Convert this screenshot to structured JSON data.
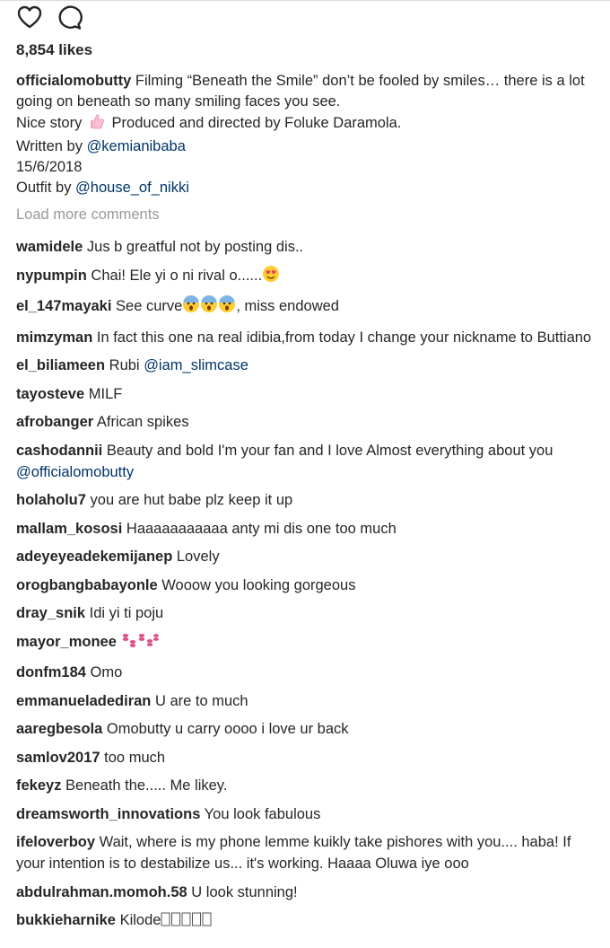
{
  "post": {
    "likes": "8,854 likes",
    "caption": {
      "username": "officialomobutty",
      "line1": "Filming “Beneath the Smile” don’t be fooled by smiles… there is a lot going on beneath so many smiling faces you see.",
      "line2_a": "Nice story",
      "line2_b": "Produced and directed by Foluke Daramola.",
      "line3_prefix": "Written by",
      "line3_mention": "@kemianibaba",
      "line4": "15/6/2018",
      "line5_prefix": "Outfit by",
      "line5_mention": "@house_of_nikki"
    },
    "load_more": "Load more comments"
  },
  "icons": {
    "like": "heart-icon",
    "comment": "comment-bubble-icon",
    "thumbs": "thumbs-up-icon",
    "love_face": "heart-eyes-emoji",
    "scared_face": "screaming-face-emoji",
    "kisses": "kiss-marks-emoji"
  },
  "comments": [
    {
      "user": "wamidele",
      "text": "Jus b greatful not by posting dis.."
    },
    {
      "user": "nypumpin",
      "text": "Chai! Ele yi o ni rival o......"
    },
    {
      "user": "el_147mayaki",
      "text": "See curve",
      "text_after": ", miss endowed"
    },
    {
      "user": "mimzyman",
      "text": "In fact this one na real idibia,from today I change your nickname to Buttiano"
    },
    {
      "user": "el_biliameen",
      "text": "Rubi",
      "mention": "@iam_slimcase"
    },
    {
      "user": "tayosteve",
      "text": "MILF"
    },
    {
      "user": "afrobanger",
      "text": "African spikes"
    },
    {
      "user": "cashodannii",
      "text": "Beauty and bold I'm your fan and I love Almost everything about you",
      "mention": "@officialomobutty"
    },
    {
      "user": "holaholu7",
      "text": "you are hut babe plz keep it up"
    },
    {
      "user": "mallam_kososi",
      "text": "Haaaaaaaaaaa anty mi dis one too much"
    },
    {
      "user": "adeyeyeadekemijanep",
      "text": "Lovely"
    },
    {
      "user": "orogbangbabayonle",
      "text": "Wooow you looking gorgeous"
    },
    {
      "user": "dray_snik",
      "text": "Idi yi ti poju"
    },
    {
      "user": "mayor_monee",
      "text": ""
    },
    {
      "user": "donfm184",
      "text": "Omo"
    },
    {
      "user": "emmanueladediran",
      "text": "U are to much"
    },
    {
      "user": "aaregbesola",
      "text": "Omobutty u carry oooo i love ur back"
    },
    {
      "user": "samlov2017",
      "text": "too much"
    },
    {
      "user": "fekeyz",
      "text": "Beneath the..... Me likey."
    },
    {
      "user": "dreamsworth_innovations",
      "text": "You look fabulous"
    },
    {
      "user": "ifeloverboy",
      "text": "Wait, where is my phone lemme kuikly take pishores with you.... haba! If your intention is to destabilize us... it's working. Haaaa Oluwa iye ooo"
    },
    {
      "user": "abdulrahman.momoh.58",
      "text": "U look stunning!"
    },
    {
      "user": "bukkieharnike",
      "text": "Kilode"
    }
  ]
}
